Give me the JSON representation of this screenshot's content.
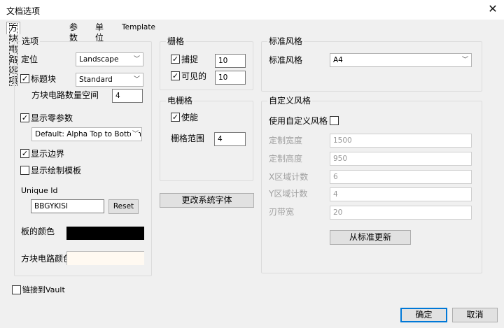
{
  "window": {
    "title": "文档选项",
    "close_icon": "close-icon"
  },
  "tabs": [
    {
      "label": "方块电路选项",
      "active": true
    },
    {
      "label": "参数"
    },
    {
      "label": "单位"
    },
    {
      "label": "Template"
    }
  ],
  "options": {
    "group_label": "选项",
    "orientation_label": "定位",
    "orientation_value": "Landscape",
    "title_block_label": "标题块",
    "title_block_checked": true,
    "title_block_value": "Standard",
    "sheet_count_label": "方块电路数量空间",
    "sheet_count_value": "4",
    "show_zero_params_label": "显示零参数",
    "show_zero_params_checked": true,
    "default_value": "Default: Alpha Top to Bottom",
    "show_border_label": "显示边界",
    "show_border_checked": true,
    "show_template_label": "显示绘制模板",
    "show_template_checked": false,
    "unique_id_label": "Unique Id",
    "unique_id_value": "BBGYKISI",
    "reset_label": "Reset",
    "board_color_label": "板的颜色",
    "board_color": "#000000",
    "sheet_color_label": "方块电路颜色",
    "sheet_color": "#fff9f1"
  },
  "grid": {
    "group_label": "栅格",
    "snap_label": "捕捉",
    "snap_checked": true,
    "snap_value": "10",
    "visible_label": "可见的",
    "visible_checked": true,
    "visible_value": "10"
  },
  "electrical_grid": {
    "group_label": "电栅格",
    "enable_label": "使能",
    "enable_checked": true,
    "range_label": "栅格范围",
    "range_value": "4"
  },
  "change_font_label": "更改系统字体",
  "standard_style": {
    "group_label": "标准风格",
    "label": "标准风格",
    "value": "A4"
  },
  "custom_style": {
    "group_label": "自定义风格",
    "use_label": "使用自定义风格",
    "use_checked": false,
    "fields": [
      {
        "label": "定制宽度",
        "value": "1500"
      },
      {
        "label": "定制高度",
        "value": "950"
      },
      {
        "label": "X区域计数",
        "value": "6"
      },
      {
        "label": "Y区域计数",
        "value": "4"
      },
      {
        "label": "刃带宽",
        "value": "20"
      }
    ],
    "update_label": "从标准更新"
  },
  "link_vault_label": "链接到Vault",
  "link_vault_checked": false,
  "ok_label": "确定",
  "cancel_label": "取消"
}
